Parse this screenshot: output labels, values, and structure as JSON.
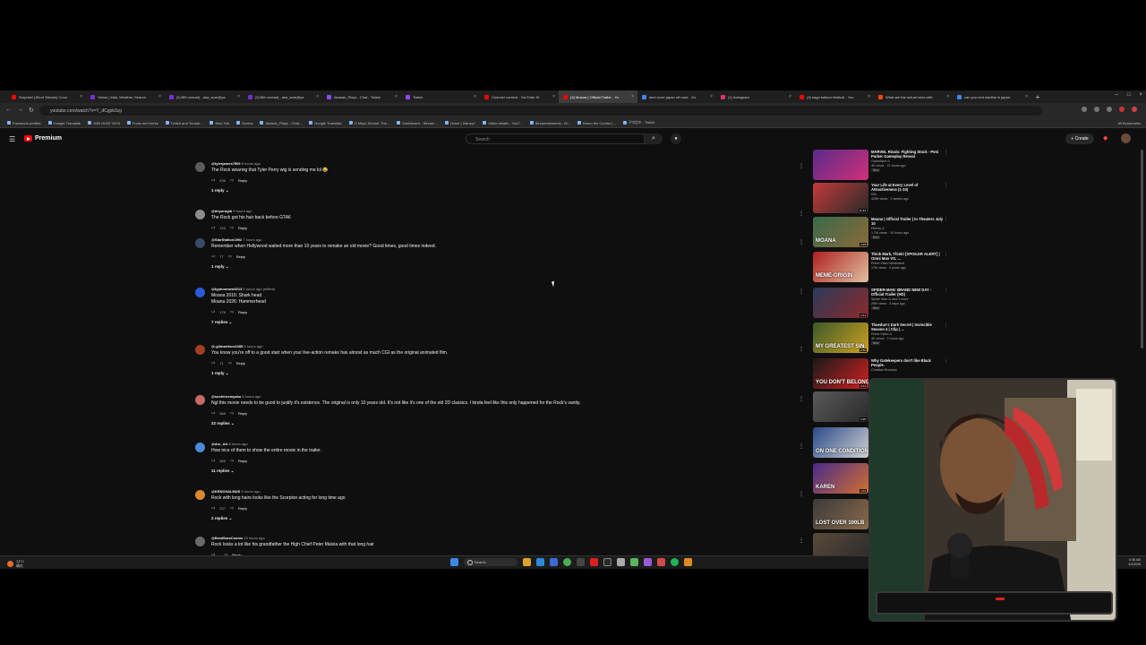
{
  "browser": {
    "tabs": [
      {
        "label": "Surprise! (Short Stream) Coun",
        "color": "#ff0000"
      },
      {
        "label": "Yahoo | Mail, Weather, Search",
        "color": "#7b2bd6"
      },
      {
        "label": "(5,089 unread) - aka_sore@ya",
        "color": "#7b2bd6"
      },
      {
        "label": "(5,089 unread) - aka_sore@ya",
        "color": "#7b2bd6"
      },
      {
        "label": "Akasan_Plays - Chat - Twitch",
        "color": "#9146ff"
      },
      {
        "label": "Twitch",
        "color": "#9146ff"
      },
      {
        "label": "Channel content - YouTube St",
        "color": "#ff0000"
      },
      {
        "label": "(3) Moana | Official Trailer - Yo",
        "color": "#ff0000"
      },
      {
        "label": "land rover japan off road - Go",
        "color": "#4285f4"
      },
      {
        "label": "(1) Instagram",
        "color": "#e1306c"
      },
      {
        "label": "(4) saga balloon festival - You",
        "color": "#ff0000"
      },
      {
        "label": "What are the actual rules with",
        "color": "#ff4500"
      },
      {
        "label": "can you rent starlink in japan",
        "color": "#4285f4"
      }
    ],
    "active_tab": 7,
    "url": "youtube.com/watch?v=Y_dCgpk3zg",
    "bookmarks": [
      "Facebook profiles",
      "Google Translate",
      "JOB HUNT 2023",
      "Fools and fronts",
      "Twitch and Youtub...",
      "New Tab",
      "Oculus",
      "Akasan_Plays - Chat...",
      "Google Translate",
      "O Mayo Sensei: The...",
      "Dashboard - Stream...",
      "Home | Disney+",
      "Video details - YouT...",
      "Streamelements - M...",
      "Demo the Course |...",
      "구미양조 - Twitch"
    ],
    "all_bookmarks": "All Bookmarks"
  },
  "youtube": {
    "brand": "Premium",
    "search_placeholder": "Search",
    "create_label": "Create"
  },
  "comments": [
    {
      "author": "@tylerjames7906",
      "when": "6 hours ago",
      "text": "The Rock wearing that Tyler Perry wig is sending me lol 😂",
      "likes": "436",
      "replies": "1 reply",
      "avatar": "#5b5b5b"
    },
    {
      "author": "@dsyorogib",
      "when": "9 hours ago",
      "text": "The Rock got his hair back before GTA6",
      "likes": "133",
      "replies": "",
      "avatar": "#8c8c8c"
    },
    {
      "author": "@StarStation1992",
      "when": "7 hours ago",
      "text": "Remember when Hollywood waited more than 10 years to remake an old movie? Good times, good times indeed.",
      "likes": "77",
      "replies": "1 reply",
      "avatar": "#3a4a6a"
    },
    {
      "author": "@typhoonwolf213",
      "when": "6 hours ago (edited)",
      "text": "Moana 2016: Shark head\nMoana 2026: Hammerhead",
      "likes": "178",
      "replies": "7 replies",
      "avatar": "#2a5ad8"
    },
    {
      "author": "@-gilmartinez2285",
      "when": "8 hours ago",
      "text": "You know you're off to a good start when your live-action remake has almost as much CGI as the original animated film.",
      "likes": "71",
      "replies": "1 reply",
      "avatar": "#a04020"
    },
    {
      "author": "@sochiroemyaku",
      "when": "8 hours ago",
      "text": "Ngl this movie needs to be good to justify it's existence. The original is only 10 years old. It's not like it's one of the old 2D classics. I kinda feel like this only happened for the Rock's vanity.",
      "likes": "588",
      "replies": "22 replies",
      "avatar": "#c86a6a"
    },
    {
      "author": "@dru_Art",
      "when": "8 hours ago",
      "text": "How nice of them to show the entire movie in the trailer.",
      "likes": "365",
      "replies": "11 replies",
      "avatar": "#4a8ad8"
    },
    {
      "author": "@KENCHALMUS",
      "when": "5 hours ago",
      "text": "Rock with long hairs looks like the Scorpion acting for long time ago",
      "likes": "237",
      "replies": "2 replies",
      "avatar": "#d88a2a"
    },
    {
      "author": "@BradSaraCooms",
      "when": "10 hours ago",
      "text": "Rock looks a lot like his grandfather the High Chief Peter Maivia with that long hair",
      "likes": "",
      "replies": "",
      "avatar": "#6a6a6a"
    }
  ],
  "comment_reply_label": "Reply",
  "related": [
    {
      "title": "MARVEL Rivals: Fighting Stock - Peni Parker Gameplay Reveal",
      "channel": "GameSpot ⊙",
      "meta": "4K views · 21 hours ago",
      "badge": "New",
      "caption": "",
      "duration": "",
      "colors": [
        "#5a2a8a",
        "#d0307a"
      ]
    },
    {
      "title": "Your Life at Every Level of Attractiveness (1-10)",
      "channel": "Kifu",
      "meta": "429K views · 2 weeks ago",
      "badge": "",
      "caption": "",
      "duration": "11:43",
      "colors": [
        "#c43a3a",
        "#2a2a2a"
      ]
    },
    {
      "title": "Moana | Official Trailer | In Theaters July 10",
      "channel": "Disney ⊙",
      "meta": "1.7M views · 10 hours ago",
      "badge": "New",
      "caption": "MOANA",
      "duration": "2:26",
      "colors": [
        "#3a6a4a",
        "#8a6a3a"
      ]
    },
    {
      "title": "Think Mark, Think! [SPOILER ALERT] | Omni Man VS. ...",
      "channel": "Prime Video Nederland",
      "meta": "17M views · 4 years ago",
      "badge": "",
      "caption": "MEME-ORIGIN",
      "duration": "",
      "colors": [
        "#b02020",
        "#e0c0a0"
      ]
    },
    {
      "title": "SPIDER-MAN: BRAND NEW DAY - Official Trailer (HD)",
      "channel": "Spider Man ⊙ and 3 more",
      "meta": "26M views · 3 days ago",
      "badge": "New",
      "caption": "",
      "duration": "2:41",
      "colors": [
        "#2a3a5a",
        "#8a2a2a"
      ]
    },
    {
      "title": "Thaedus's Dark Secret | Invincible Season 4 | Clip | ...",
      "channel": "Prime Video ⊙",
      "meta": "4K views · 2 hours ago",
      "badge": "New",
      "caption": "MY GREATEST SIN",
      "duration": "2:56",
      "colors": [
        "#3a5a2a",
        "#d0a020"
      ]
    },
    {
      "title": "Why Gatekeepers don't like Black People.",
      "channel": "Christian Bruneau",
      "meta": "",
      "badge": "",
      "caption": "YOU DON'T BELONG",
      "duration": "9:42",
      "colors": [
        "#1a1a1a",
        "#d02020"
      ]
    },
    {
      "title": "",
      "channel": "",
      "meta": "",
      "badge": "",
      "caption": "",
      "duration": "2:28",
      "colors": [
        "#5a5a5a",
        "#2a2a2a"
      ]
    },
    {
      "title": "",
      "channel": "",
      "meta": "",
      "badge": "",
      "caption": "ON ONE CONDITION",
      "duration": "",
      "colors": [
        "#2a4a8a",
        "#d0d0d0"
      ]
    },
    {
      "title": "",
      "channel": "",
      "meta": "",
      "badge": "",
      "caption": "KAREN",
      "duration": "1:01",
      "colors": [
        "#4a2a8a",
        "#d07030"
      ]
    },
    {
      "title": "",
      "channel": "",
      "meta": "",
      "badge": "",
      "caption": "LOST OVER 100LB",
      "duration": "",
      "colors": [
        "#3a3a3a",
        "#8a6a4a"
      ]
    },
    {
      "title": "",
      "channel": "",
      "meta": "",
      "badge": "",
      "caption": "",
      "duration": "",
      "colors": [
        "#5a4a3a",
        "#2a2a2a"
      ]
    }
  ],
  "taskbar": {
    "weather": "13°C",
    "weather_sub": "晴れ",
    "search_label": "Search",
    "time": "6:46 AM",
    "date": "4/1/2026"
  }
}
